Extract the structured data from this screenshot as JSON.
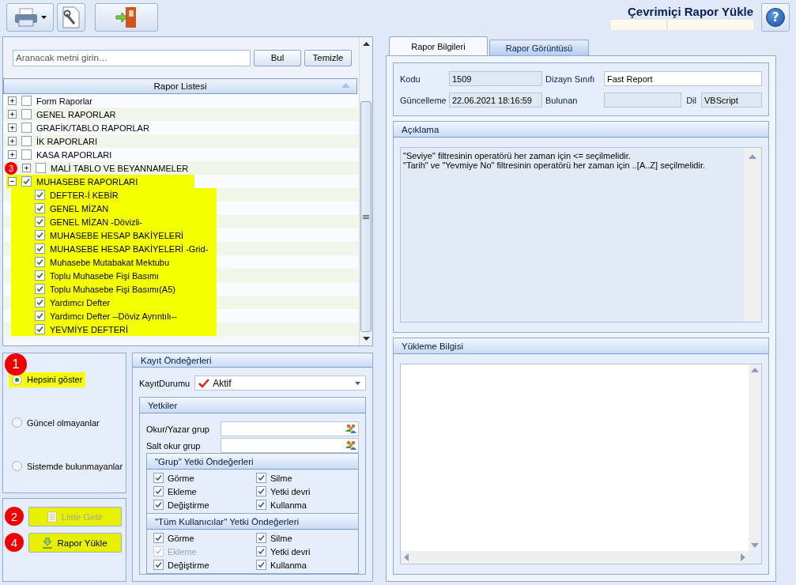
{
  "window": {
    "title": "Çevrimiçi Rapor Yükle",
    "help_button": "?"
  },
  "search": {
    "placeholder": "Aranacak metni girin…",
    "buttons": [
      "Bul",
      "Temizle"
    ]
  },
  "report_list": {
    "header": "Rapor Listesi",
    "nodes": [
      {
        "label": "Form Raporlar",
        "checked": false,
        "expanded": false,
        "highlighted": false
      },
      {
        "label": "GENEL RAPORLAR",
        "checked": false,
        "expanded": false,
        "highlighted": false
      },
      {
        "label": "GRAFİK/TABLO RAPORLAR",
        "checked": false,
        "expanded": false,
        "highlighted": false
      },
      {
        "label": "İK RAPORLARI",
        "checked": false,
        "expanded": false,
        "highlighted": false
      },
      {
        "label": "KASA RAPORLARI",
        "checked": false,
        "expanded": false,
        "highlighted": false
      },
      {
        "label": "MALİ TABLO VE BEYANNAMELER",
        "checked": false,
        "expanded": false,
        "highlighted": false,
        "badge": "3"
      },
      {
        "label": "MUHASEBE RAPORLARI",
        "checked": true,
        "expanded": true,
        "highlighted": true,
        "children": [
          {
            "label": "DEFTER-İ KEBİR",
            "checked": true,
            "highlighted": true
          },
          {
            "label": "GENEL MİZAN",
            "checked": true,
            "highlighted": true
          },
          {
            "label": "GENEL MİZAN -Dövizli-",
            "checked": true,
            "highlighted": true
          },
          {
            "label": "MUHASEBE HESAP BAKİYELERİ",
            "checked": true,
            "highlighted": true
          },
          {
            "label": "MUHASEBE HESAP BAKİYELERİ -Grid-",
            "checked": true,
            "highlighted": true
          },
          {
            "label": "Muhasebe Mutabakat Mektubu",
            "checked": true,
            "highlighted": true
          },
          {
            "label": "Toplu Muhasebe Fişi Basımı",
            "checked": true,
            "highlighted": true
          },
          {
            "label": "Toplu Muhasebe Fişi Basımı(A5)",
            "checked": true,
            "highlighted": true
          },
          {
            "label": "Yardımcı Defter",
            "checked": true,
            "highlighted": true
          },
          {
            "label": "Yardımcı Defter --Döviz Ayrıntılı--",
            "checked": true,
            "highlighted": true
          },
          {
            "label": "YEVMİYE DEFTERİ",
            "checked": true,
            "highlighted": true
          }
        ]
      }
    ]
  },
  "filter_options": [
    {
      "label": "Hepsini göster",
      "selected": true,
      "highlighted": true,
      "badge": "1"
    },
    {
      "label": "Güncel olmayanlar",
      "selected": false,
      "highlighted": false
    },
    {
      "label": "Sistemde bulunmayanlar",
      "selected": false,
      "highlighted": false
    }
  ],
  "actions": [
    {
      "label": "Liste Getir",
      "kind": "list",
      "disabled": true,
      "highlighted": true,
      "badge": "2"
    },
    {
      "label": "Rapor Yükle",
      "kind": "upload",
      "disabled": false,
      "highlighted": true,
      "badge": "4"
    }
  ],
  "record_defaults": {
    "title": "Kayıt Öndeğerleri",
    "status_label": "KayıtDurumu",
    "status_value": "Aktif",
    "permissions": {
      "title": "Yetkiler",
      "groups": [
        {
          "label": "Okur/Yazar grup"
        },
        {
          "label": "Salt okur grup"
        }
      ],
      "sections": [
        {
          "title": "\"Grup\" Yetki Öndeğerleri",
          "items": [
            {
              "label": "Görme",
              "checked": true,
              "disabled": false
            },
            {
              "label": "Silme",
              "checked": true,
              "disabled": false
            },
            {
              "label": "Ekleme",
              "checked": true,
              "disabled": false
            },
            {
              "label": "Yetki devri",
              "checked": true,
              "disabled": false
            },
            {
              "label": "Değiştirme",
              "checked": true,
              "disabled": false
            },
            {
              "label": "Kullanma",
              "checked": true,
              "disabled": false
            }
          ]
        },
        {
          "title": "\"Tüm Kullanıcılar\" Yetki Öndeğerleri",
          "items": [
            {
              "label": "Görme",
              "checked": true,
              "disabled": false
            },
            {
              "label": "Silme",
              "checked": true,
              "disabled": false
            },
            {
              "label": "Ekleme",
              "checked": true,
              "disabled": true
            },
            {
              "label": "Yetki devri",
              "checked": true,
              "disabled": false
            },
            {
              "label": "Değiştirme",
              "checked": true,
              "disabled": false
            },
            {
              "label": "Kullanma",
              "checked": true,
              "disabled": false
            }
          ]
        }
      ]
    }
  },
  "tabs": [
    {
      "label": "Rapor Bilgileri",
      "selected": true
    },
    {
      "label": "Rapor Görüntüsü",
      "selected": false
    }
  ],
  "info": {
    "code_label": "Kodu",
    "code": "1509",
    "design_label": "Dizayn Sınıfı",
    "design": "Fast Report",
    "updated_label": "Güncelleme",
    "updated": "22.06.2021 18:16:59",
    "found_label": "Bulunan",
    "lang_label": "Dil",
    "lang": "VBScript"
  },
  "description": {
    "title": "Açıklama",
    "lines": [
      "\"Seviye\" filtresinin operatörü her zaman için <= seçilmelidir.",
      "\"Tarih\" ve \"Yevmiye No\" filtresinin operatörü her zaman için ..[A..Z] seçilmelidir."
    ]
  },
  "upload_info": {
    "title": "Yükleme Bilgisi"
  }
}
